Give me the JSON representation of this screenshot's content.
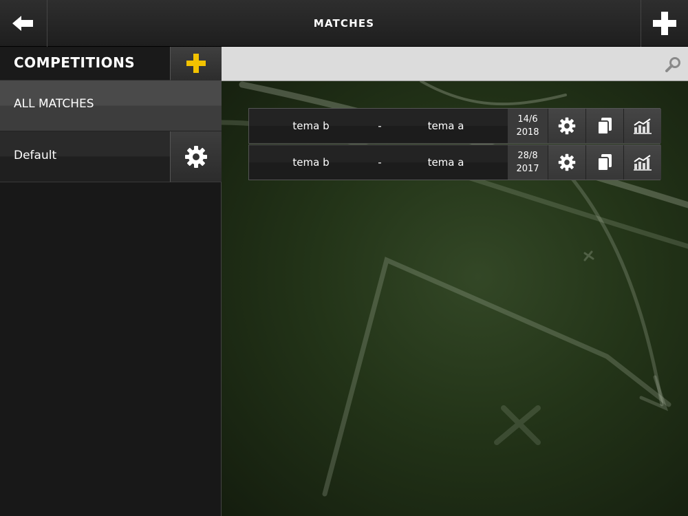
{
  "header": {
    "title": "MATCHES",
    "back_icon": "arrow-left-icon",
    "add_icon": "plus-icon"
  },
  "sidebar": {
    "competitions_title": "COMPETITIONS",
    "add_competition_icon": "plus-icon",
    "accent_color": "#f2c200",
    "items": [
      {
        "label": "ALL MATCHES",
        "selected": true
      },
      {
        "label": "Default",
        "icon": "gear-icon"
      }
    ]
  },
  "search": {
    "value": "",
    "placeholder": "",
    "icon": "search-icon"
  },
  "matches": [
    {
      "home": "tema b",
      "separator": "-",
      "away": "tema a",
      "date_day": "14/6",
      "date_year": "2018",
      "actions": [
        "gear-icon",
        "copy-icon",
        "stats-chart-icon"
      ]
    },
    {
      "home": "tema b",
      "separator": "-",
      "away": "tema a",
      "date_day": "28/8",
      "date_year": "2017",
      "actions": [
        "gear-icon",
        "copy-icon",
        "stats-chart-icon"
      ]
    }
  ]
}
